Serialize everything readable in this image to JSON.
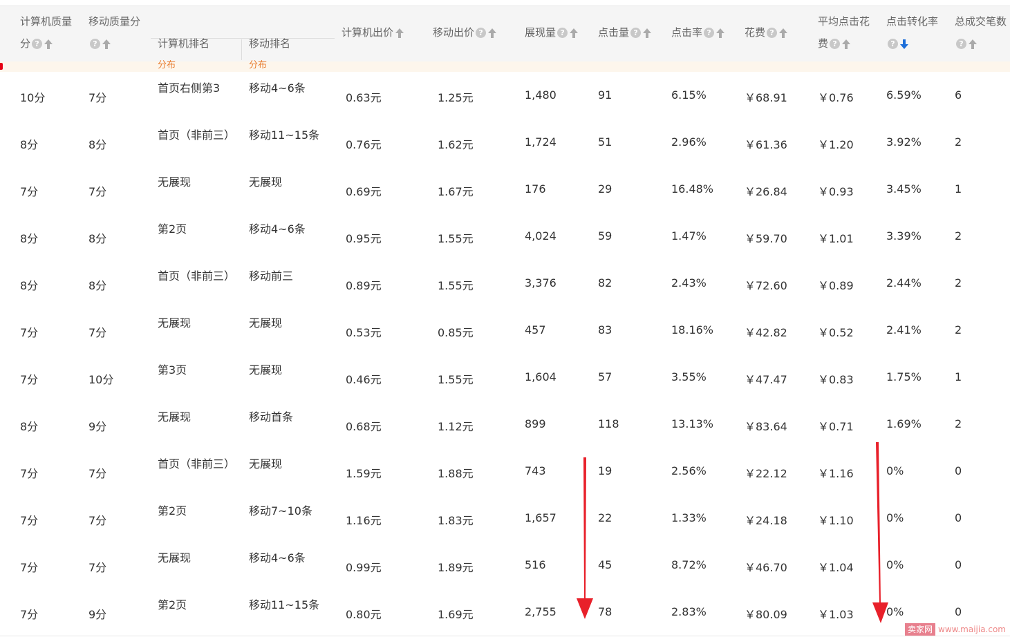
{
  "headers": {
    "pc_quality": [
      "计算机质量",
      "分"
    ],
    "mobile_quality": "移动质量分",
    "pc_rank": "计算机排名",
    "mobile_rank": "移动排名",
    "pc_bid": "计算机出价",
    "mobile_bid": "移动出价",
    "impressions": "展现量",
    "clicks": "点击量",
    "ctr": "点击率",
    "cost": "花费",
    "avg_cpc": [
      "平均点击花",
      "费"
    ],
    "conversion_rate": "点击转化率",
    "orders": "总成交笔数",
    "strip_left": "分布",
    "strip_right": "分布"
  },
  "help_glyph": "?",
  "rows": [
    {
      "pcq": "10分",
      "mq": "7分",
      "pcr": "首页右侧第3",
      "mr": "移动4~6条",
      "pcb": "0.63元",
      "mb": "1.25元",
      "imp": "1,480",
      "clk": "91",
      "ctr": "6.15%",
      "cost": "￥68.91",
      "cpc": "￥0.76",
      "cvr": "6.59%",
      "ord": "6"
    },
    {
      "pcq": "8分",
      "mq": "8分",
      "pcr": "首页（非前三）",
      "mr": "移动11~15条",
      "pcb": "0.76元",
      "mb": "1.62元",
      "imp": "1,724",
      "clk": "51",
      "ctr": "2.96%",
      "cost": "￥61.36",
      "cpc": "￥1.20",
      "cvr": "3.92%",
      "ord": "2"
    },
    {
      "pcq": "7分",
      "mq": "7分",
      "pcr": "无展现",
      "mr": "无展现",
      "pcb": "0.69元",
      "mb": "1.67元",
      "imp": "176",
      "clk": "29",
      "ctr": "16.48%",
      "cost": "￥26.84",
      "cpc": "￥0.93",
      "cvr": "3.45%",
      "ord": "1"
    },
    {
      "pcq": "8分",
      "mq": "8分",
      "pcr": "第2页",
      "mr": "移动4~6条",
      "pcb": "0.95元",
      "mb": "1.55元",
      "imp": "4,024",
      "clk": "59",
      "ctr": "1.47%",
      "cost": "￥59.70",
      "cpc": "￥1.01",
      "cvr": "3.39%",
      "ord": "2"
    },
    {
      "pcq": "8分",
      "mq": "8分",
      "pcr": "首页（非前三）",
      "mr": "移动前三",
      "pcb": "0.89元",
      "mb": "1.55元",
      "imp": "3,376",
      "clk": "82",
      "ctr": "2.43%",
      "cost": "￥72.60",
      "cpc": "￥0.89",
      "cvr": "2.44%",
      "ord": "2"
    },
    {
      "pcq": "7分",
      "mq": "7分",
      "pcr": "无展现",
      "mr": "无展现",
      "pcb": "0.53元",
      "mb": "0.85元",
      "imp": "457",
      "clk": "83",
      "ctr": "18.16%",
      "cost": "￥42.82",
      "cpc": "￥0.52",
      "cvr": "2.41%",
      "ord": "2"
    },
    {
      "pcq": "7分",
      "mq": "10分",
      "pcr": "第3页",
      "mr": "无展现",
      "pcb": "0.46元",
      "mb": "1.55元",
      "imp": "1,604",
      "clk": "57",
      "ctr": "3.55%",
      "cost": "￥47.47",
      "cpc": "￥0.83",
      "cvr": "1.75%",
      "ord": "1"
    },
    {
      "pcq": "8分",
      "mq": "9分",
      "pcr": "无展现",
      "mr": "移动首条",
      "pcb": "0.68元",
      "mb": "1.12元",
      "imp": "899",
      "clk": "118",
      "ctr": "13.13%",
      "cost": "￥83.64",
      "cpc": "￥0.71",
      "cvr": "1.69%",
      "ord": "2"
    },
    {
      "pcq": "7分",
      "mq": "7分",
      "pcr": "首页（非前三）",
      "mr": "无展现",
      "pcb": "1.59元",
      "mb": "1.88元",
      "imp": "743",
      "clk": "19",
      "ctr": "2.56%",
      "cost": "￥22.12",
      "cpc": "￥1.16",
      "cvr": "0%",
      "ord": "0"
    },
    {
      "pcq": "7分",
      "mq": "7分",
      "pcr": "第2页",
      "mr": "移动7~10条",
      "pcb": "1.16元",
      "mb": "1.83元",
      "imp": "1,657",
      "clk": "22",
      "ctr": "1.33%",
      "cost": "￥24.18",
      "cpc": "￥1.10",
      "cvr": "0%",
      "ord": "0"
    },
    {
      "pcq": "7分",
      "mq": "7分",
      "pcr": "无展现",
      "mr": "移动4~6条",
      "pcb": "0.99元",
      "mb": "1.89元",
      "imp": "516",
      "clk": "45",
      "ctr": "8.72%",
      "cost": "￥46.70",
      "cpc": "￥1.04",
      "cvr": "0%",
      "ord": "0"
    },
    {
      "pcq": "7分",
      "mq": "9分",
      "pcr": "第2页",
      "mr": "移动11~15条",
      "pcb": "0.80元",
      "mb": "1.69元",
      "imp": "2,755",
      "clk": "78",
      "ctr": "2.83%",
      "cost": "￥80.09",
      "cpc": "￥1.03",
      "cvr": "0%",
      "ord": "0"
    }
  ],
  "sort_active": "conversion_rate",
  "colors": {
    "accent_blue": "#1e6fd9",
    "annotation_red": "#e8202a",
    "header_bg": "#f5f5f5"
  },
  "watermark": {
    "brand": "卖家网",
    "url": "www.maijia.com"
  }
}
